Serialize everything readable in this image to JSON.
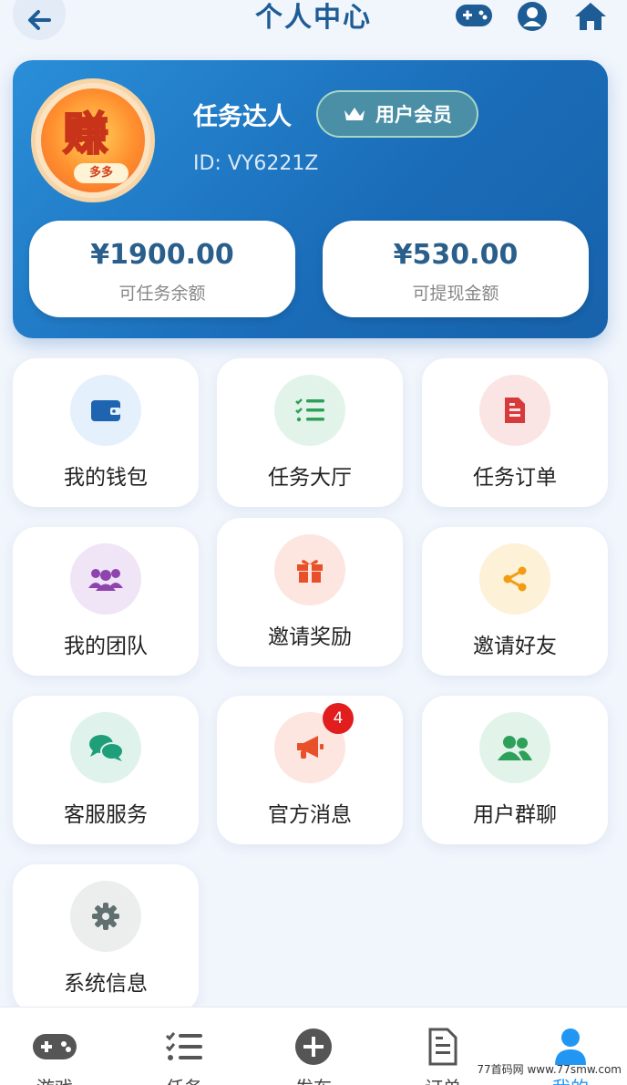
{
  "header": {
    "title": "个人中心",
    "icons": [
      "back-arrow-icon",
      "gamepad-icon",
      "user-circle-icon",
      "home-icon"
    ]
  },
  "profile": {
    "avatar_char": "赚",
    "avatar_tag": "多多",
    "nickname": "任务达人",
    "vip_label": "用户会员",
    "id_text": "ID: VY6221Z",
    "balances": [
      {
        "amount": "¥1900.00",
        "label": "可任务余额"
      },
      {
        "amount": "¥530.00",
        "label": "可提现金额"
      }
    ]
  },
  "tiles": [
    {
      "label": "我的钱包",
      "icon": "wallet-icon",
      "bg": "#e4f0fb",
      "color": "#1e64b0"
    },
    {
      "label": "任务大厅",
      "icon": "task-list-icon",
      "bg": "#e2f4ea",
      "color": "#2fa05a"
    },
    {
      "label": "任务订单",
      "icon": "file-icon",
      "bg": "#fbe4e4",
      "color": "#d63a3a"
    },
    {
      "label": "我的团队",
      "icon": "users-icon",
      "bg": "#efe5f6",
      "color": "#8e44ad"
    },
    {
      "label": "邀请奖励",
      "icon": "gift-icon",
      "bg": "#fde5e0",
      "color": "#e8502a"
    },
    {
      "label": "邀请好友",
      "icon": "share-icon",
      "bg": "#fdf1d8",
      "color": "#f39c12"
    },
    {
      "label": "客服服务",
      "icon": "chat-icon",
      "bg": "#dff3ec",
      "color": "#1f9e7a"
    },
    {
      "label": "官方消息",
      "icon": "megaphone-icon",
      "bg": "#fde5e0",
      "color": "#e8502a",
      "badge": "4"
    },
    {
      "label": "用户群聊",
      "icon": "group-icon",
      "bg": "#e2f4ea",
      "color": "#2fa05a"
    },
    {
      "label": "系统信息",
      "icon": "gear-icon",
      "bg": "#eceeee",
      "color": "#607070"
    }
  ],
  "nav": [
    {
      "label": "游戏",
      "icon": "gamepad-icon"
    },
    {
      "label": "任务",
      "icon": "task-list-icon"
    },
    {
      "label": "发布",
      "icon": "plus-circle-icon"
    },
    {
      "label": "订单",
      "icon": "file-icon"
    },
    {
      "label": "我的",
      "icon": "user-icon",
      "active": true
    }
  ],
  "watermark": "77首码网 www.77smw.com",
  "colors": {
    "accent": "#1e5c96",
    "active_nav": "#2196f3",
    "card_gradient_start": "#2a8ed8",
    "card_gradient_end": "#1762ab"
  }
}
